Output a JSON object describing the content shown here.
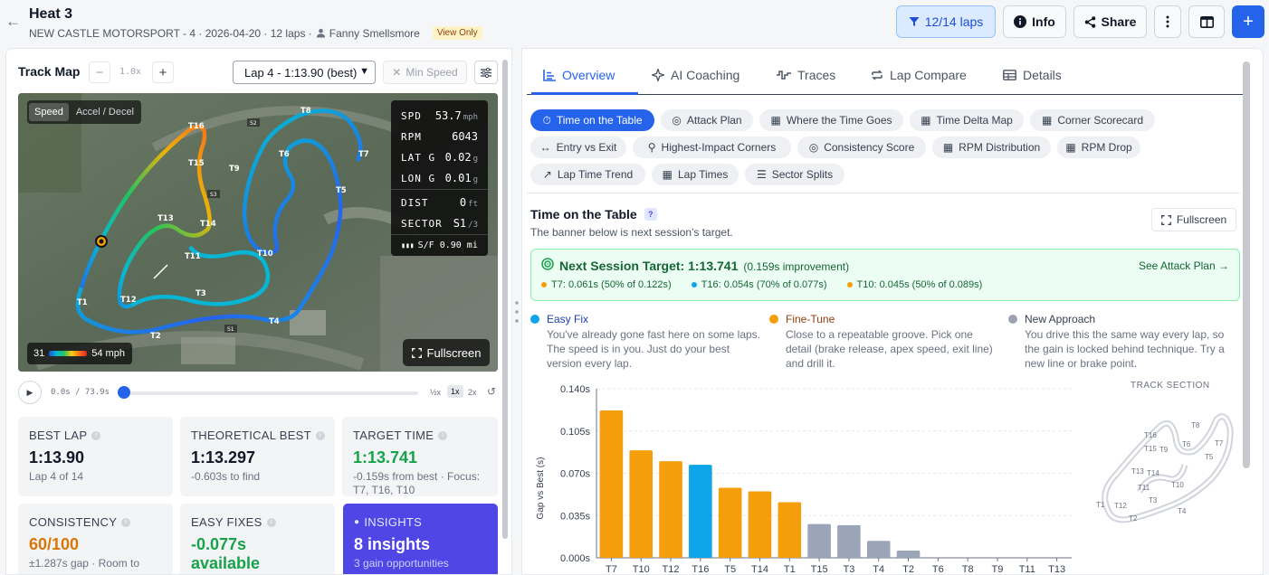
{
  "header": {
    "title": "Heat 3",
    "subtitle": "NEW CASTLE MOTORSPORT - 4 · 2026-04-20 · 12 laps ·",
    "driver": "Fanny Smellsmore",
    "badge": "View Only",
    "laps_filter": "12/14 laps",
    "info_label": "Info",
    "share_label": "Share"
  },
  "track_map": {
    "title": "Track Map",
    "zoom": "1.0x",
    "lap_select": "Lap 4 - 1:13.90 (best)",
    "min_speed": "Min Speed",
    "toggle": [
      "Speed",
      "Accel / Decel"
    ],
    "telemetry": [
      {
        "label": "SPD",
        "value": "53.7",
        "unit": "mph"
      },
      {
        "label": "RPM",
        "value": "6043",
        "unit": ""
      },
      {
        "label": "LAT G",
        "value": "0.02",
        "unit": "g"
      },
      {
        "label": "LON G",
        "value": "0.01",
        "unit": "g"
      },
      {
        "label": "DIST",
        "value": "0",
        "unit": "ft"
      },
      {
        "label": "SECTOR",
        "value": "S1",
        "unit": "/3"
      }
    ],
    "sf": "S/F 0.90 mi",
    "legend_min": "31",
    "legend_max": "54 mph",
    "fullscreen": "Fullscreen",
    "corners": [
      "T1",
      "T2",
      "T3",
      "T4",
      "T5",
      "T6",
      "T7",
      "T8",
      "T9",
      "T10",
      "T11",
      "T12",
      "T13",
      "T14",
      "T15",
      "T16"
    ],
    "sectors": [
      "S1",
      "S2",
      "S3"
    ]
  },
  "player": {
    "time": "0.0s / 73.9s",
    "speeds": [
      "½x",
      "1x",
      "2x"
    ],
    "progress": 0
  },
  "stats": {
    "best_lap": {
      "label": "BEST LAP",
      "value": "1:13.90",
      "sub": "Lap 4 of 14"
    },
    "theoretical": {
      "label": "THEORETICAL BEST",
      "value": "1:13.297",
      "sub": "-0.603s to find"
    },
    "target": {
      "label": "TARGET TIME",
      "value": "1:13.741",
      "sub": "-0.159s from best · Focus: T7, T16, T10"
    },
    "consistency": {
      "label": "CONSISTENCY",
      "value": "60/100",
      "sub": "±1.287s gap · Room to"
    },
    "easy_fixes": {
      "label": "EASY FIXES",
      "value": "-0.077s",
      "value2": "available"
    },
    "insights": {
      "label": "INSIGHTS",
      "value": "8 insights",
      "sub": "3 gain opportunities"
    }
  },
  "tabs": [
    "Overview",
    "AI Coaching",
    "Traces",
    "Lap Compare",
    "Details"
  ],
  "pills": [
    "Time on the Table",
    "Attack Plan",
    "Where the Time Goes",
    "Time Delta Map",
    "Corner Scorecard",
    "Entry vs Exit",
    "Highest-Impact Corners",
    "Consistency Score",
    "RPM Distribution",
    "RPM Drop",
    "Lap Time Trend",
    "Lap Times",
    "Sector Splits"
  ],
  "section": {
    "title": "Time on the Table",
    "help": "?",
    "subtitle": "The banner below is next session's target.",
    "fullscreen": "Fullscreen"
  },
  "target_banner": {
    "title": "Next Session Target: 1:13.741",
    "improvement": "(0.159s improvement)",
    "link": "See Attack Plan →",
    "items": [
      {
        "text": "T7: 0.061s (50% of 0.122s)",
        "color": "#f59e0b"
      },
      {
        "text": "T16: 0.054s (70% of 0.077s)",
        "color": "#0ea5e9"
      },
      {
        "text": "T10: 0.045s (50% of 0.089s)",
        "color": "#f59e0b"
      }
    ]
  },
  "categories": [
    {
      "name": "Easy Fix",
      "color": "#0ea5e9",
      "text_color": "#1e40af",
      "desc": "You've already gone fast here on some laps. The speed is in you. Just do your best version every lap."
    },
    {
      "name": "Fine-Tune",
      "color": "#f59e0b",
      "text_color": "#92400e",
      "desc": "Close to a repeatable groove. Pick one detail (brake release, apex speed, exit line) and drill it."
    },
    {
      "name": "New Approach",
      "color": "#9ca3af",
      "text_color": "#374151",
      "desc": "You drive this the same way every lap, so the gain is locked behind technique. Try a new line or brake point."
    }
  ],
  "track_section_label": "TRACK SECTION",
  "colors": {
    "easy": "#0ea5e9",
    "fine": "#f59e0b",
    "new": "#9aa5b8",
    "accent": "#2563eb"
  },
  "chart_data": {
    "type": "bar",
    "title": "",
    "xlabel": "",
    "ylabel": "Gap vs Best (s)",
    "ylim": [
      0,
      0.14
    ],
    "yticks": [
      "0.000s",
      "0.035s",
      "0.070s",
      "0.105s",
      "0.140s"
    ],
    "grid": true,
    "categories": [
      "T7",
      "T10",
      "T12",
      "T16",
      "T5",
      "T14",
      "T1",
      "T15",
      "T3",
      "T4",
      "T2",
      "T6",
      "T8",
      "T9",
      "T11",
      "T13"
    ],
    "values": [
      0.122,
      0.089,
      0.08,
      0.077,
      0.058,
      0.055,
      0.046,
      0.028,
      0.027,
      0.014,
      0.006,
      0,
      0,
      0,
      0,
      0
    ],
    "bar_category": [
      "fine",
      "fine",
      "fine",
      "easy",
      "fine",
      "fine",
      "fine",
      "new",
      "new",
      "new",
      "new",
      "new",
      "new",
      "new",
      "new",
      "new"
    ]
  }
}
